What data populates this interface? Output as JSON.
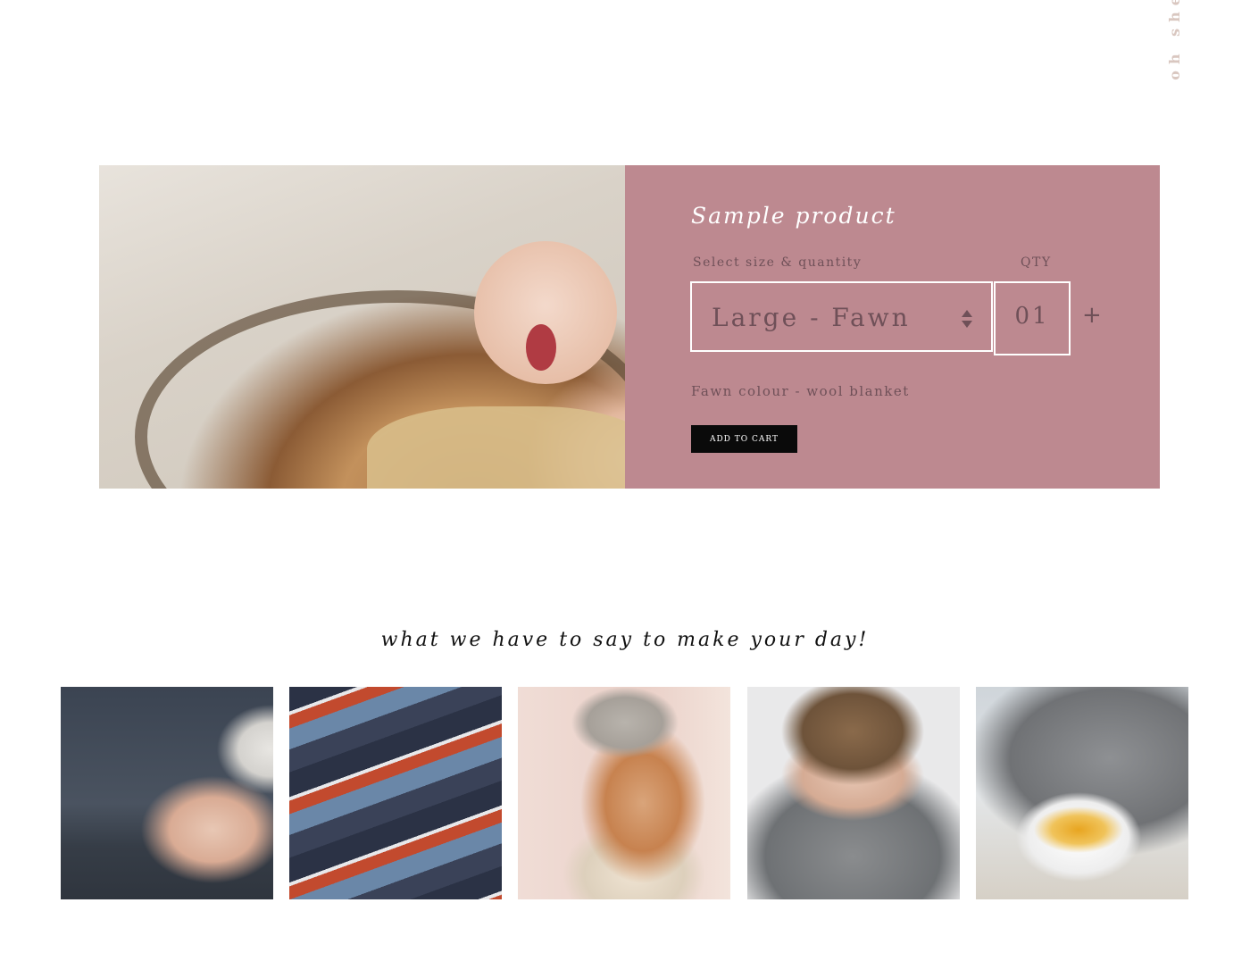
{
  "brand": {
    "vertical_text": "oh she"
  },
  "product": {
    "image_alt": "newborn baby yawning in a fawn wool blanket inside a basket",
    "title": "Sample product",
    "select_label": "Select size & quantity",
    "qty_label": "QTY",
    "size_value": "Large - Fawn",
    "qty_value": "01",
    "qty_plus": "+",
    "description": "Fawn colour - wool blanket",
    "add_to_cart_label": "ADD TO CART",
    "panel_color": "#bd8990"
  },
  "section": {
    "tagline": "what we have to say to make your day!"
  },
  "gallery": [
    {
      "alt": "sleeping baby in knit bear hat"
    },
    {
      "alt": "patterned knit blanket"
    },
    {
      "alt": "girl in chunky knit hat and scarf"
    },
    {
      "alt": "man wrapped in grey knit scarf"
    },
    {
      "alt": "tea cup on tray with grey knit sweater"
    }
  ]
}
